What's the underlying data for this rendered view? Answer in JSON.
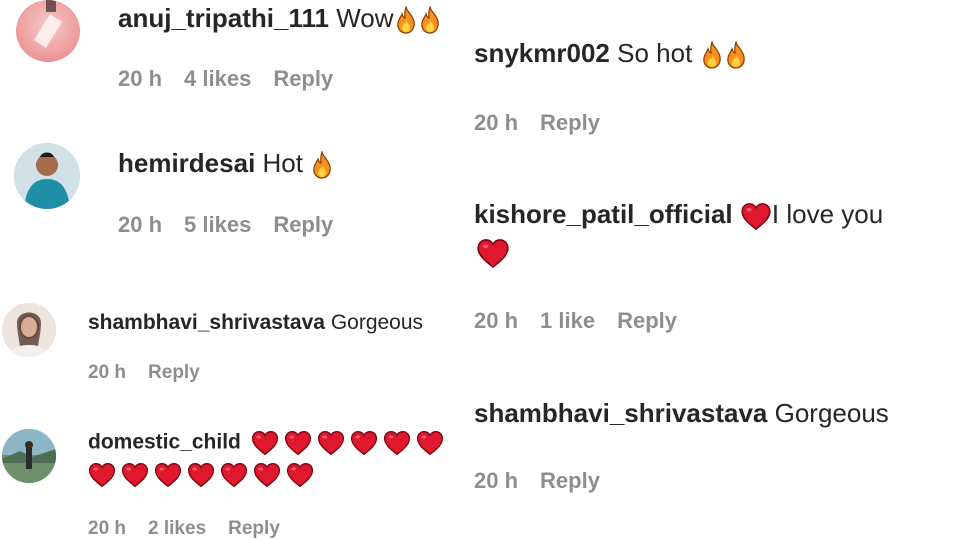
{
  "comments_left": [
    {
      "username": "anuj_tripathi_111",
      "text": "Wow",
      "emojis": [
        "fire-emoji",
        "fire-emoji"
      ],
      "time": "20 h",
      "likes": "4 likes",
      "reply": "Reply"
    },
    {
      "username": "hemirdesai",
      "text": "Hot",
      "emojis": [
        "fire-emoji"
      ],
      "time": "20 h",
      "likes": "5 likes",
      "reply": "Reply"
    },
    {
      "username": "shambhavi_shrivastava",
      "text": "Gorgeous",
      "time": "20 h",
      "reply": "Reply"
    },
    {
      "username": "domestic_child",
      "emojis_line1": 6,
      "emojis_line2": 7,
      "emoji_name": "red-heart-emoji",
      "time": "20 h",
      "likes": "2 likes",
      "reply": "Reply"
    }
  ],
  "comments_right": [
    {
      "username": "snykmr002",
      "text": "So hot",
      "emojis": [
        "fire-emoji",
        "fire-emoji"
      ],
      "time": "20 h",
      "reply": "Reply"
    },
    {
      "username": "kishore_patil_official",
      "text": "I love you",
      "emojis": [
        "red-heart-emoji",
        "red-heart-emoji"
      ],
      "time": "20 h",
      "likes": "1 like",
      "reply": "Reply"
    },
    {
      "username": "shambhavi_shrivastava",
      "text": "Gorgeous",
      "time": "20 h",
      "reply": "Reply"
    }
  ],
  "colors": {
    "text": "#262626",
    "meta": "#8e8e8e",
    "heart": "#e0182d",
    "fire_outer": "#f7901e",
    "fire_inner": "#ffd23f"
  }
}
